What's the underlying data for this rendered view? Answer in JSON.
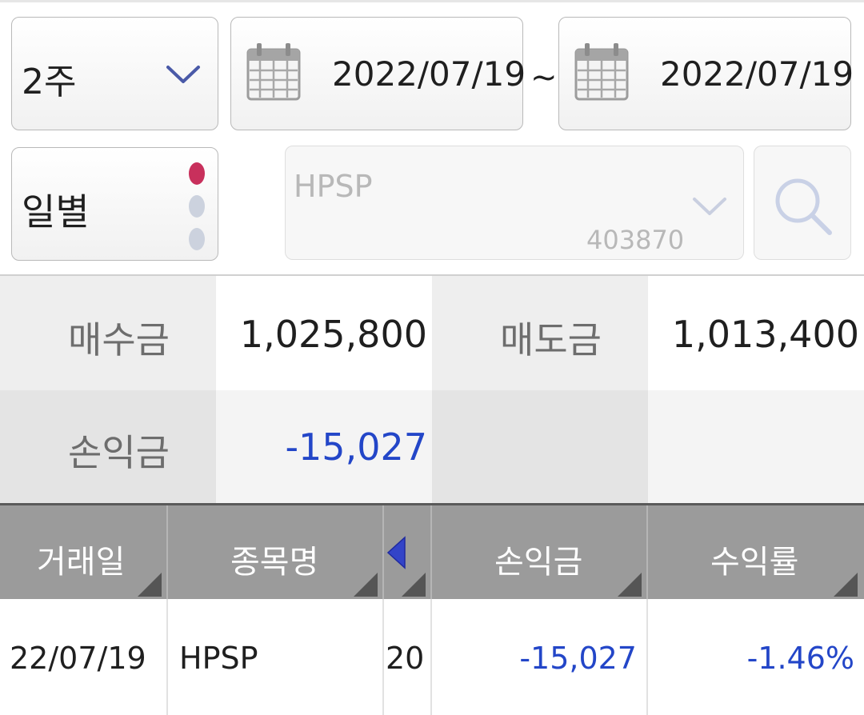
{
  "filters": {
    "period": {
      "value": "2주"
    },
    "date_range": {
      "start": "2022/07/19",
      "separator": "~",
      "end": "2022/07/19"
    },
    "view_mode": {
      "value": "일별"
    },
    "stock": {
      "name": "HPSP",
      "code": "403870"
    }
  },
  "summary": {
    "buy_label": "매수금",
    "buy_value": "1,025,800",
    "sell_label": "매도금",
    "sell_value": "1,013,400",
    "pnl_label": "손익금",
    "pnl_value": "-15,027"
  },
  "table": {
    "headers": {
      "date": "거래일",
      "name": "종목명",
      "pnl": "손익금",
      "rate": "수익률"
    },
    "rows": [
      {
        "date": "22/07/19",
        "name": "HPSP",
        "qty": "20",
        "pnl": "-15,027",
        "rate": "-1.46%"
      }
    ]
  },
  "colors": {
    "accent_dot": "#c8305c",
    "negative_value": "#2346c8",
    "header_bg": "#9b9b9b"
  }
}
